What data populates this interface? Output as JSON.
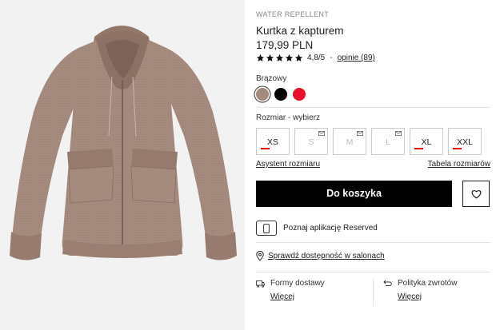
{
  "product": {
    "badge": "WATER REPELLENT",
    "title": "Kurtka z kapturem",
    "price": "179,99 PLN",
    "rating": {
      "stars": 5,
      "score": "4,8/5",
      "separator": "-",
      "reviews_link": "opinie (89)"
    },
    "image_icon": "brown-hooded-jacket-image"
  },
  "colors": {
    "label": "Brązowy",
    "options": [
      {
        "name": "brown",
        "hex": "#a58a7e",
        "selected": true
      },
      {
        "name": "black",
        "hex": "#000000",
        "selected": false
      },
      {
        "name": "red",
        "hex": "#e8102a",
        "selected": false
      }
    ]
  },
  "sizes": {
    "label": "Rozmiar -  wybierz",
    "options": [
      {
        "label": "XS",
        "available": true,
        "low_stock": true,
        "notify": false
      },
      {
        "label": "S",
        "available": false,
        "low_stock": false,
        "notify": true
      },
      {
        "label": "M",
        "available": false,
        "low_stock": false,
        "notify": true
      },
      {
        "label": "L",
        "available": false,
        "low_stock": false,
        "notify": true
      },
      {
        "label": "XL",
        "available": true,
        "low_stock": true,
        "notify": false
      },
      {
        "label": "XXL",
        "available": true,
        "low_stock": true,
        "notify": false
      }
    ],
    "assistant_link": "Asystent rozmiaru",
    "table_link": "Tabela rozmiarów"
  },
  "actions": {
    "add_to_cart": "Do koszyka",
    "wishlist_icon": "heart-icon"
  },
  "app": {
    "text": "Poznaj aplikację Reserved",
    "icon": "phone-icon"
  },
  "stores": {
    "text": "Sprawdź dostępność w salonach",
    "icon": "location-pin-icon"
  },
  "delivery": {
    "title": "Formy dostawy",
    "link": "Więcej",
    "icon": "truck-icon"
  },
  "returns": {
    "title": "Polityka zwrotów",
    "link": "Więcej",
    "icon": "return-arrow-icon"
  },
  "colors_theme": {
    "accent": "#000000",
    "low_stock": "#e00000",
    "background_image": "#f2f2f2"
  }
}
